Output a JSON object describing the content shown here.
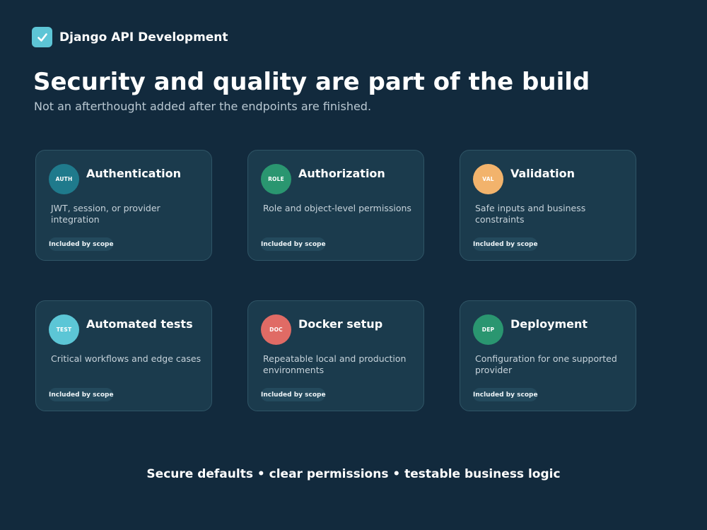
{
  "brand": {
    "name": "Django API Development",
    "logo_icon": "checkmark-icon",
    "logo_color": "#5dc5d6"
  },
  "header": {
    "title": "Security and quality are part of the build",
    "subtitle": "Not an afterthought added after the endpoints are finished."
  },
  "cards": [
    {
      "icon_label": "AUTH",
      "icon_color": "#1f7a8c",
      "title": "Authentication",
      "description": "JWT, session, or provider integration",
      "badge": "Included by scope"
    },
    {
      "icon_label": "ROLE",
      "icon_color": "#2a9670",
      "title": "Authorization",
      "description": "Role and object-level permissions",
      "badge": "Included by scope"
    },
    {
      "icon_label": "VAL",
      "icon_color": "#f2b36c",
      "title": "Validation",
      "description": "Safe inputs and business constraints",
      "badge": "Included by scope"
    },
    {
      "icon_label": "TEST",
      "icon_color": "#5cc6d6",
      "title": "Automated tests",
      "description": "Critical workflows and edge cases",
      "badge": "Included by scope"
    },
    {
      "icon_label": "DOC",
      "icon_color": "#e06b65",
      "title": "Docker setup",
      "description": "Repeatable local and production environments",
      "badge": "Included by scope"
    },
    {
      "icon_label": "DEP",
      "icon_color": "#2a9670",
      "title": "Deployment",
      "description": "Configuration for one supported provider",
      "badge": "Included by scope"
    }
  ],
  "footer": {
    "tagline": "Secure defaults • clear permissions • testable business logic"
  },
  "colors": {
    "background": "#122a3d",
    "card_background": "#1b3b4d",
    "card_border": "#2f5566"
  }
}
